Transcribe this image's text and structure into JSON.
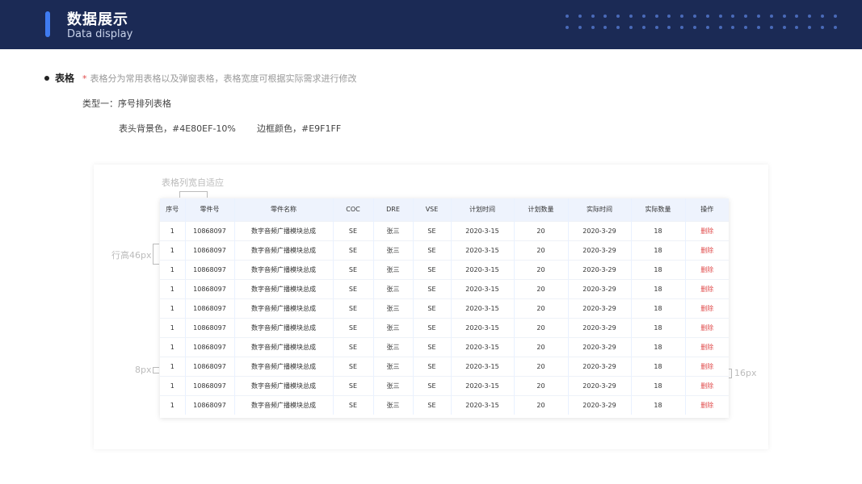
{
  "header": {
    "title": "数据展示",
    "subtitle": "Data display"
  },
  "section": {
    "title": "表格",
    "note_star": "*",
    "note": "表格分为常用表格以及弹窗表格，表格宽度可根据实际需求进行修改",
    "type_label": "类型一：序号排列表格",
    "spec_header_bg": "表头背景色，#4E80EF-10%",
    "spec_border": "边框颜色，#E9F1FF"
  },
  "colors": {
    "header_bg": "#1b2a55",
    "accent": "#4E80EF",
    "table_header_bg": "#eef3fd",
    "border": "#E9F1FF",
    "delete": "#e04b4b"
  },
  "annotations": {
    "col_auto": "表格列宽自适应",
    "row_height": "行高46px",
    "left_pad": "8px",
    "right_pad": "16px"
  },
  "table": {
    "columns": [
      "序号",
      "零件号",
      "零件名称",
      "COC",
      "DRE",
      "VSE",
      "计划时间",
      "计划数量",
      "实际时间",
      "实际数量",
      "操作"
    ],
    "rows": [
      [
        "1",
        "10868097",
        "数字音频广播模块总成",
        "SE",
        "张三",
        "SE",
        "2020-3-15",
        "20",
        "2020-3-29",
        "18",
        "删除"
      ],
      [
        "1",
        "10868097",
        "数字音频广播模块总成",
        "SE",
        "张三",
        "SE",
        "2020-3-15",
        "20",
        "2020-3-29",
        "18",
        "删除"
      ],
      [
        "1",
        "10868097",
        "数字音频广播模块总成",
        "SE",
        "张三",
        "SE",
        "2020-3-15",
        "20",
        "2020-3-29",
        "18",
        "删除"
      ],
      [
        "1",
        "10868097",
        "数字音频广播模块总成",
        "SE",
        "张三",
        "SE",
        "2020-3-15",
        "20",
        "2020-3-29",
        "18",
        "删除"
      ],
      [
        "1",
        "10868097",
        "数字音频广播模块总成",
        "SE",
        "张三",
        "SE",
        "2020-3-15",
        "20",
        "2020-3-29",
        "18",
        "删除"
      ],
      [
        "1",
        "10868097",
        "数字音频广播模块总成",
        "SE",
        "张三",
        "SE",
        "2020-3-15",
        "20",
        "2020-3-29",
        "18",
        "删除"
      ],
      [
        "1",
        "10868097",
        "数字音频广播模块总成",
        "SE",
        "张三",
        "SE",
        "2020-3-15",
        "20",
        "2020-3-29",
        "18",
        "删除"
      ],
      [
        "1",
        "10868097",
        "数字音频广播模块总成",
        "SE",
        "张三",
        "SE",
        "2020-3-15",
        "20",
        "2020-3-29",
        "18",
        "删除"
      ],
      [
        "1",
        "10868097",
        "数字音频广播模块总成",
        "SE",
        "张三",
        "SE",
        "2020-3-15",
        "20",
        "2020-3-29",
        "18",
        "删除"
      ],
      [
        "1",
        "10868097",
        "数字音频广播模块总成",
        "SE",
        "张三",
        "SE",
        "2020-3-15",
        "20",
        "2020-3-29",
        "18",
        "删除"
      ]
    ]
  }
}
